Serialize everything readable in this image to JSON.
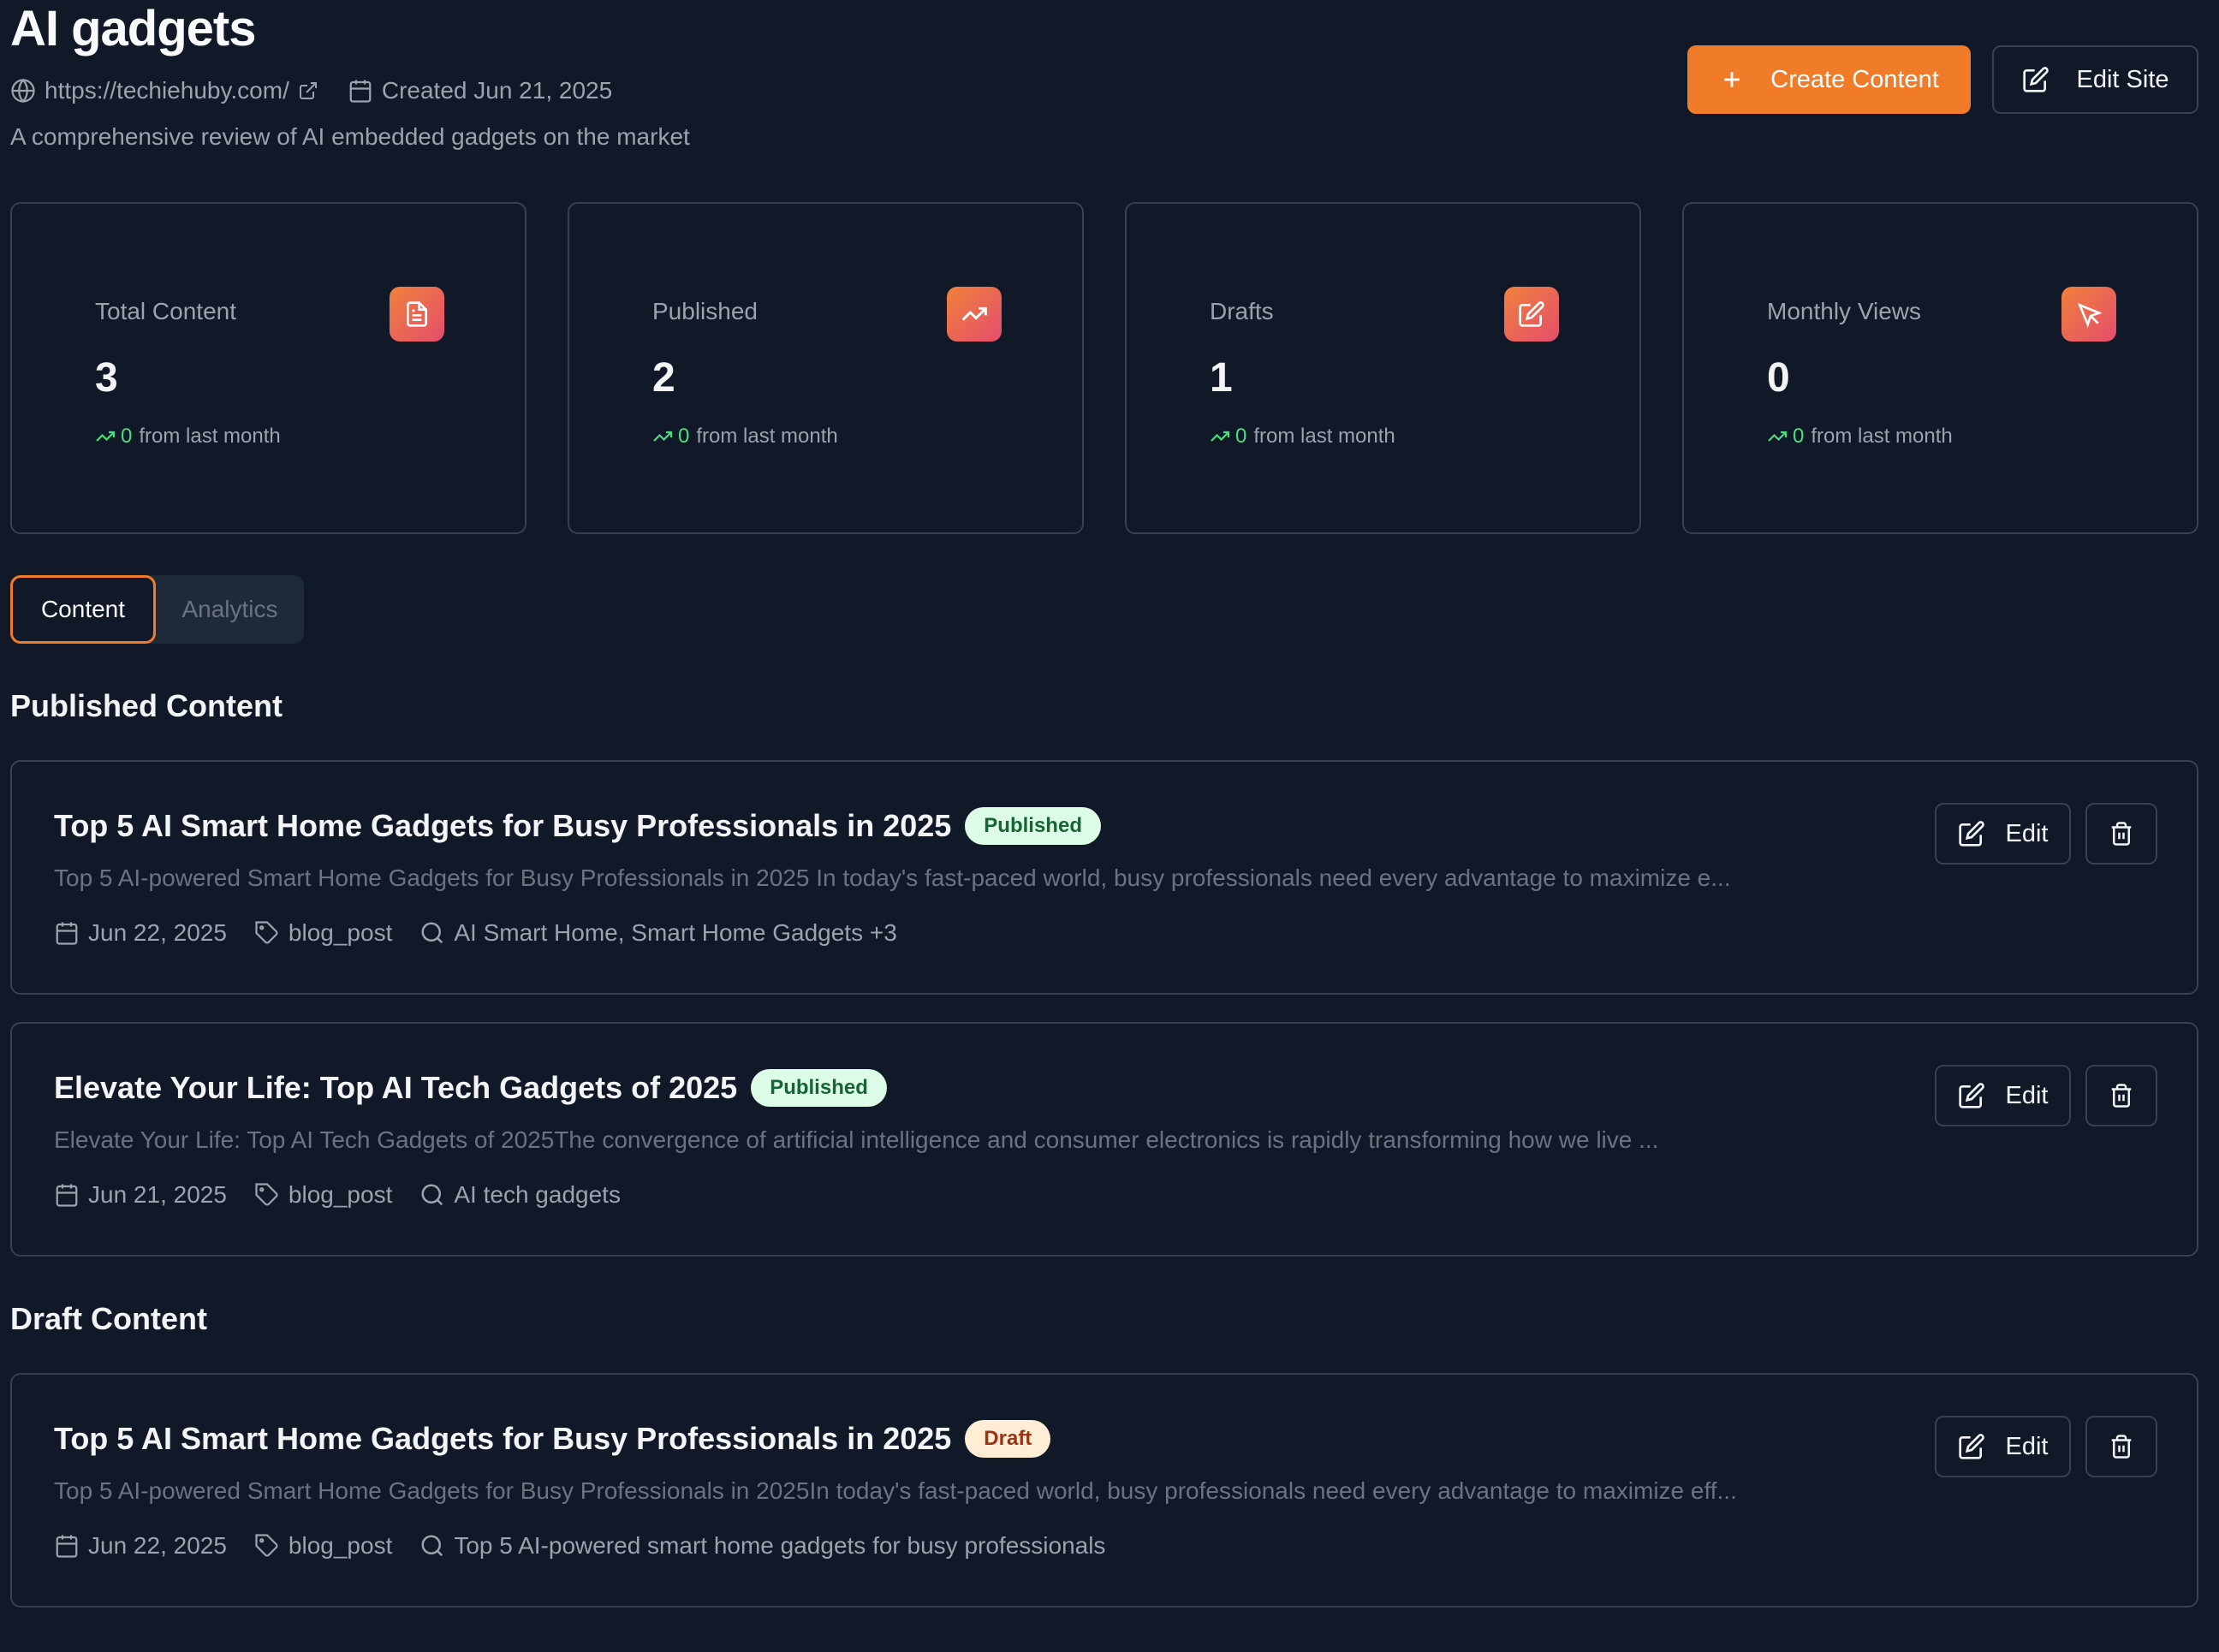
{
  "site": {
    "title": "AI gadgets",
    "url": "https://techiehuby.com/",
    "created": "Created Jun 21, 2025",
    "description": "A comprehensive review of AI embedded gadgets on the market"
  },
  "actions": {
    "create_label": "Create Content",
    "edit_site_label": "Edit Site"
  },
  "colors": {
    "accent": "#f07c2a",
    "background": "#111827",
    "trend_positive": "#4ade80",
    "published_badge": "#dcfce7",
    "draft_badge": "#ffedd5"
  },
  "stats": [
    {
      "label": "Total Content",
      "value": "3",
      "trend_value": "0",
      "trend_text": "from last month",
      "icon": "document-icon"
    },
    {
      "label": "Published",
      "value": "2",
      "trend_value": "0",
      "trend_text": "from last month",
      "icon": "trending-up-icon"
    },
    {
      "label": "Drafts",
      "value": "1",
      "trend_value": "0",
      "trend_text": "from last month",
      "icon": "edit-icon"
    },
    {
      "label": "Monthly Views",
      "value": "0",
      "trend_value": "0",
      "trend_text": "from last month",
      "icon": "cursor-icon"
    }
  ],
  "tabs": [
    {
      "label": "Content",
      "active": true
    },
    {
      "label": "Analytics",
      "active": false
    }
  ],
  "published_section": {
    "title": "Published Content",
    "items": [
      {
        "title": "Top 5 AI Smart Home Gadgets for Busy Professionals in 2025",
        "status": "Published",
        "excerpt": "Top 5 AI-powered Smart Home Gadgets for Busy Professionals in 2025 In today's fast-paced world, busy professionals need every advantage to maximize e...",
        "date": "Jun 22, 2025",
        "type": "blog_post",
        "keywords": "AI Smart Home, Smart Home Gadgets +3",
        "edit_label": "Edit"
      },
      {
        "title": "Elevate Your Life: Top AI Tech Gadgets of 2025",
        "status": "Published",
        "excerpt": "Elevate Your Life: Top AI Tech Gadgets of 2025The convergence of artificial intelligence and consumer electronics is rapidly transforming how we live ...",
        "date": "Jun 21, 2025",
        "type": "blog_post",
        "keywords": "AI tech gadgets",
        "edit_label": "Edit"
      }
    ]
  },
  "draft_section": {
    "title": "Draft Content",
    "items": [
      {
        "title": "Top 5 AI Smart Home Gadgets for Busy Professionals in 2025",
        "status": "Draft",
        "excerpt": "Top 5 AI-powered Smart Home Gadgets for Busy Professionals in 2025In today's fast-paced world, busy professionals need every advantage to maximize eff...",
        "date": "Jun 22, 2025",
        "type": "blog_post",
        "keywords": "Top 5 AI-powered smart home gadgets for busy professionals",
        "edit_label": "Edit"
      }
    ]
  }
}
